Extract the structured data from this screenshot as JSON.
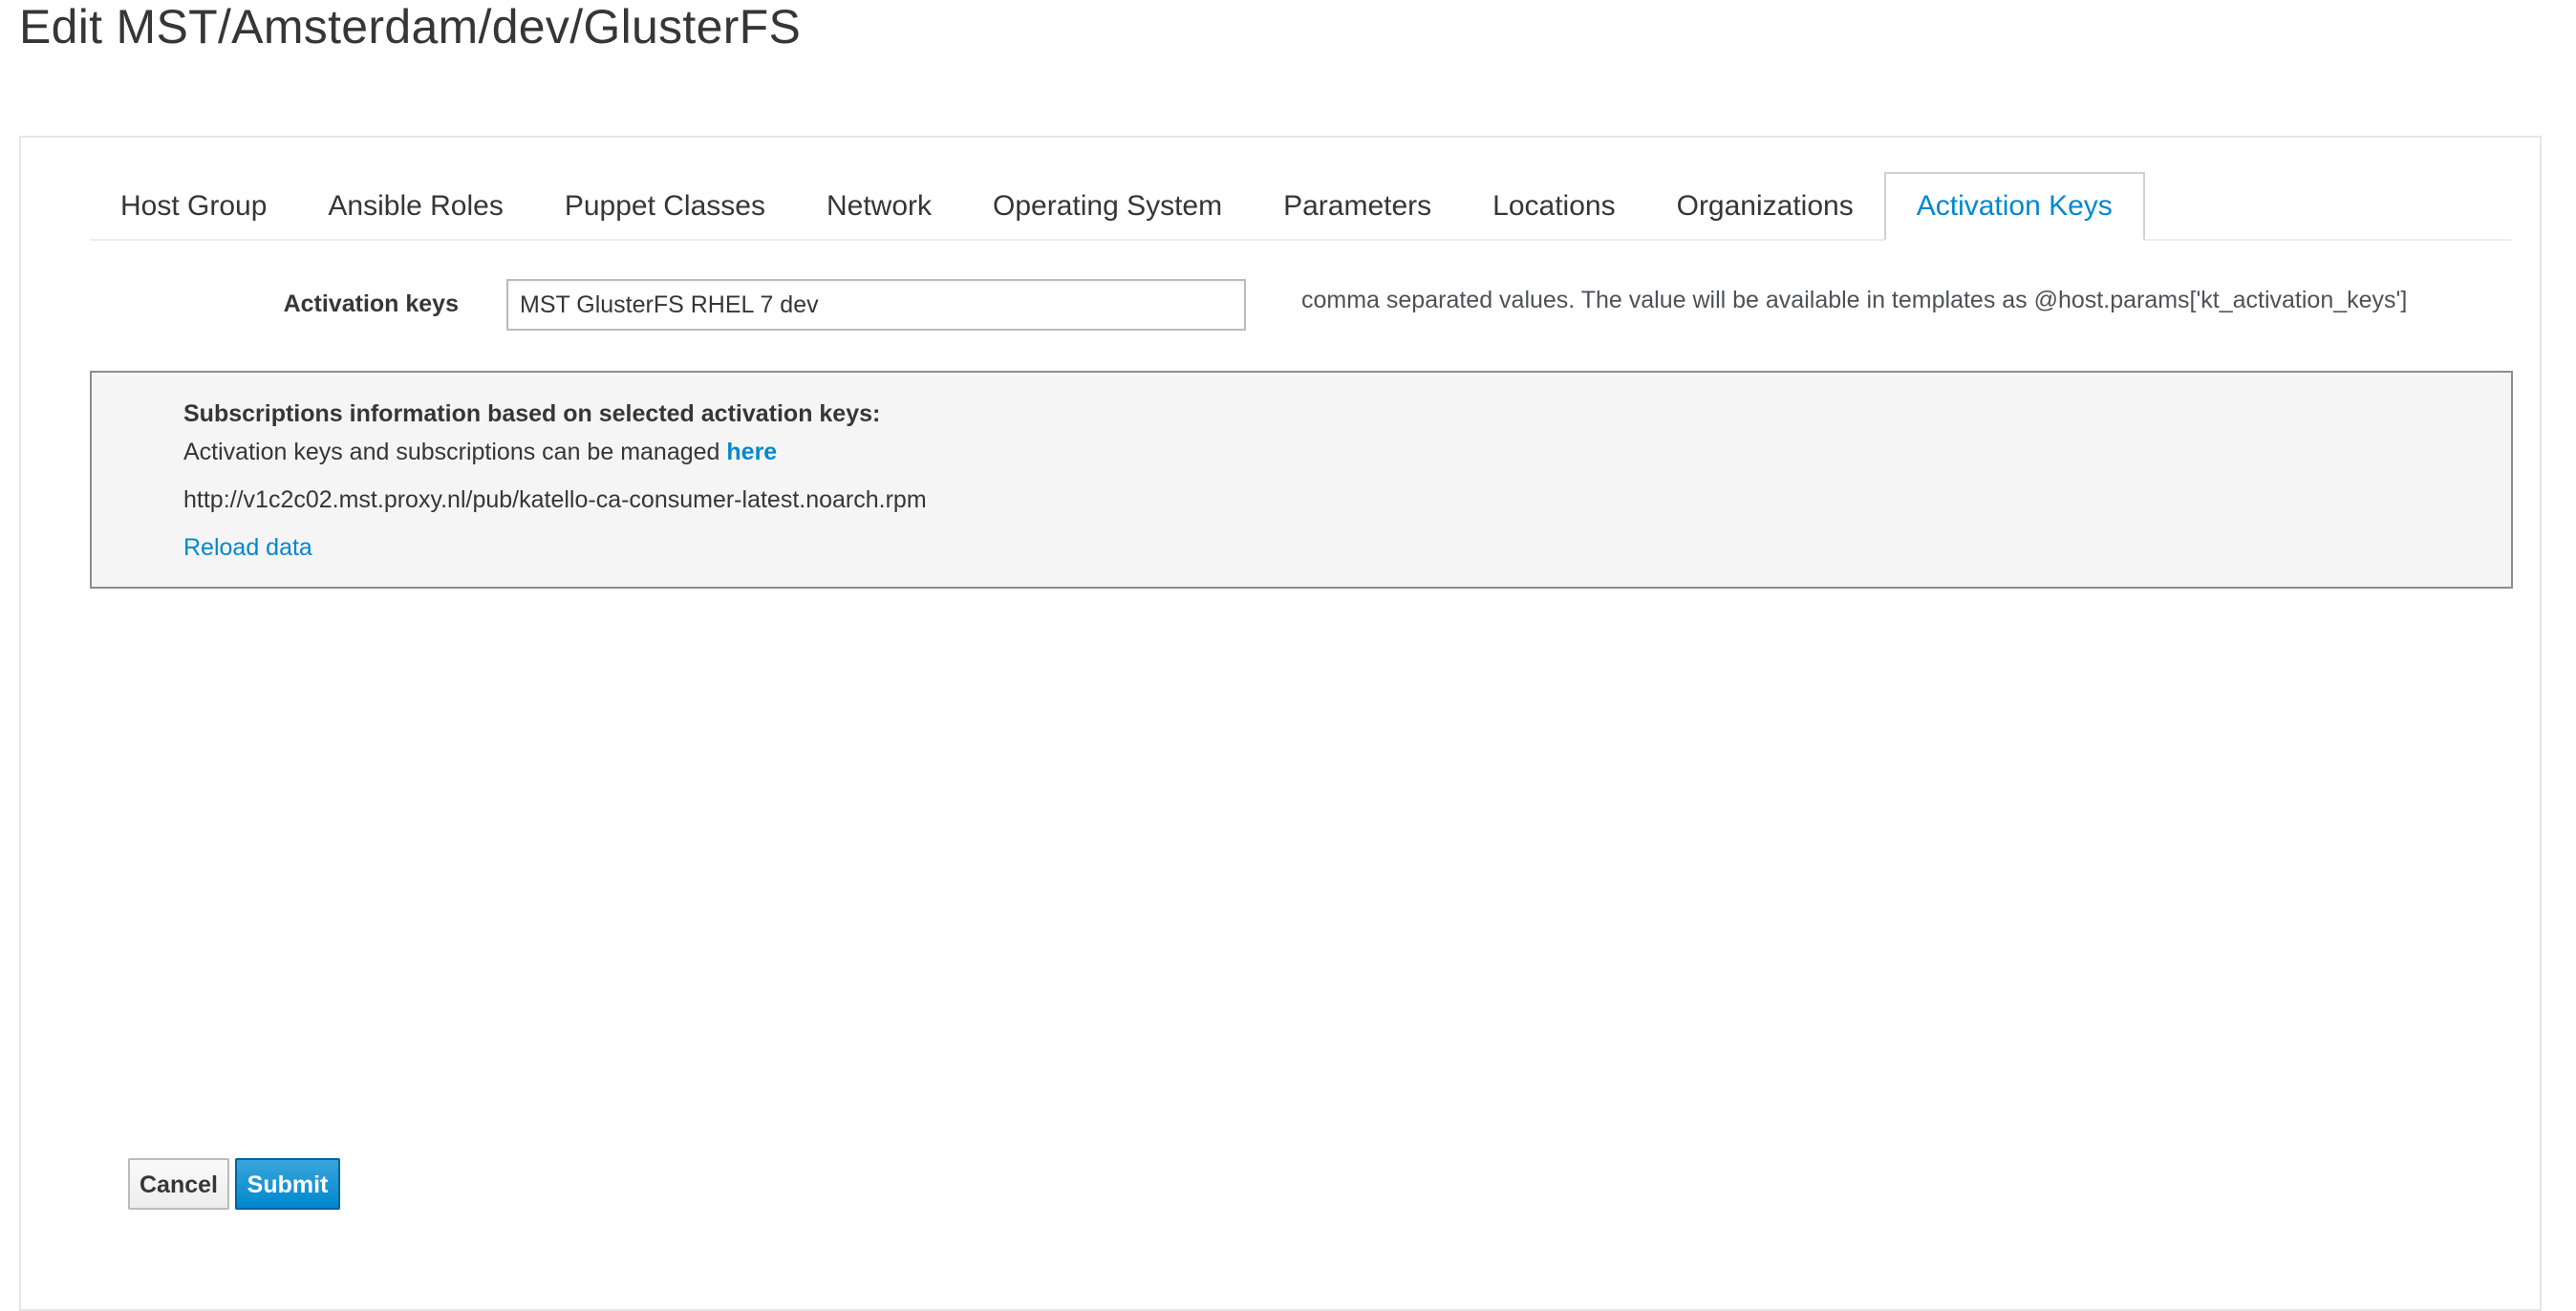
{
  "page": {
    "title": "Edit MST/Amsterdam/dev/GlusterFS"
  },
  "tabs": [
    {
      "label": "Host Group",
      "active": false
    },
    {
      "label": "Ansible Roles",
      "active": false
    },
    {
      "label": "Puppet Classes",
      "active": false
    },
    {
      "label": "Network",
      "active": false
    },
    {
      "label": "Operating System",
      "active": false
    },
    {
      "label": "Parameters",
      "active": false
    },
    {
      "label": "Locations",
      "active": false
    },
    {
      "label": "Organizations",
      "active": false
    },
    {
      "label": "Activation Keys",
      "active": true
    }
  ],
  "activation_keys_field": {
    "label": "Activation keys",
    "value": "MST GlusterFS RHEL 7 dev",
    "help": "comma separated values. The value will be available in templates as @host.params['kt_activation_keys']"
  },
  "subscriptions_info": {
    "heading": "Subscriptions information based on selected activation keys:",
    "manage_text": "Activation keys and subscriptions can be managed ",
    "manage_link": "here",
    "url": "http://v1c2c02.mst.proxy.nl/pub/katello-ca-consumer-latest.noarch.rpm",
    "reload_link": "Reload data"
  },
  "actions": {
    "cancel_label": "Cancel",
    "submit_label": "Submit"
  },
  "colors": {
    "accent": "#0088ce",
    "submit_bg": "#0088ce",
    "info_box_bg": "#f5f5f5"
  }
}
